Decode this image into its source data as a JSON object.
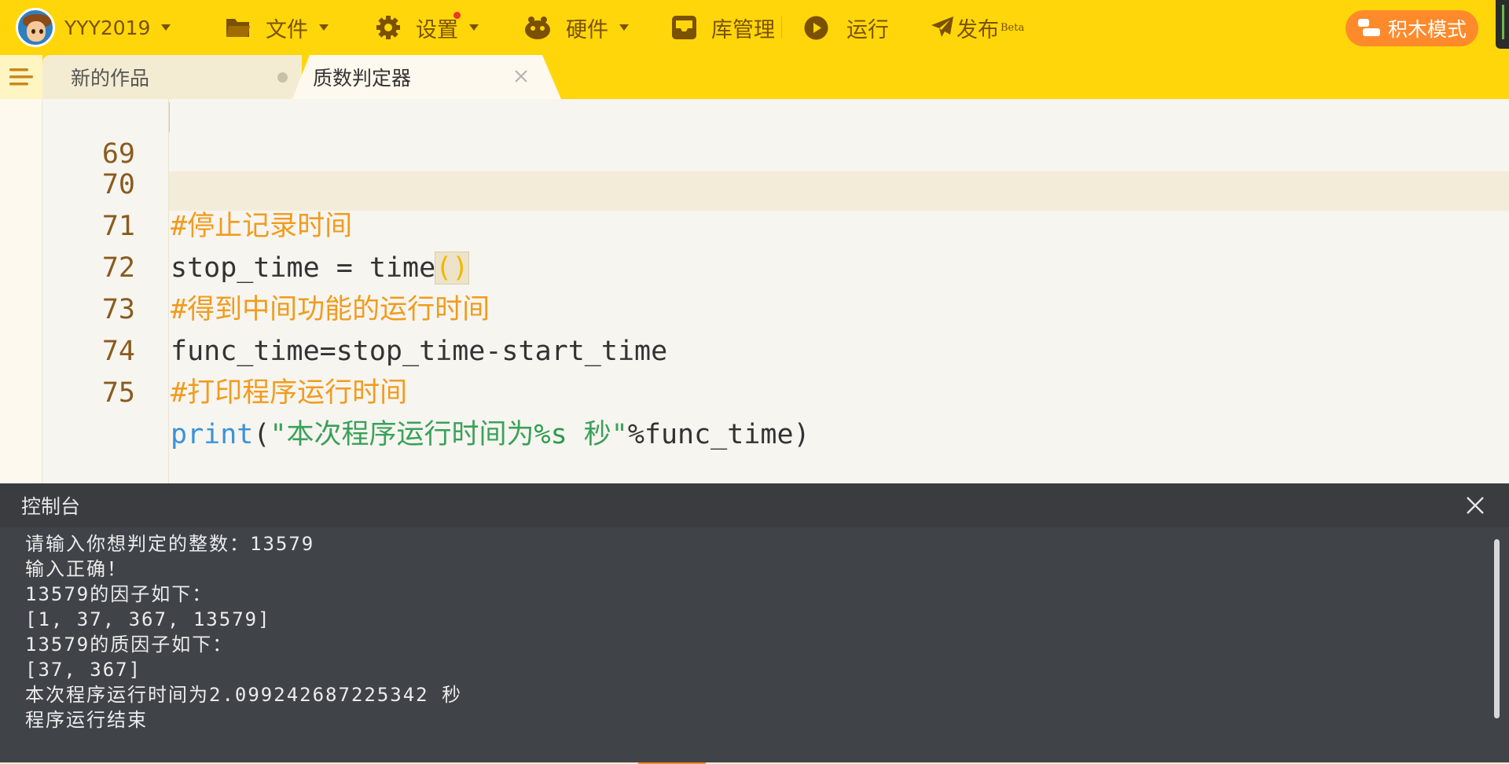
{
  "toolbar": {
    "username": "YYY2019",
    "file_label": "文件",
    "settings_label": "设置",
    "hardware_label": "硬件",
    "library_label": "库管理",
    "run_label": "运行",
    "publish_label": "发布",
    "publish_badge": "Beta",
    "block_mode_label": "积木模式"
  },
  "tabs": [
    {
      "label": "新的作品",
      "active": false
    },
    {
      "label": "质数判定器",
      "active": true
    }
  ],
  "editor": {
    "lines": [
      {
        "num": "69",
        "text": ""
      },
      {
        "num": "70",
        "text": "#停止记录时间"
      },
      {
        "num": "71",
        "before": "stop_time = time",
        "paren": "()"
      },
      {
        "num": "72",
        "text": "#得到中间功能的运行时间"
      },
      {
        "num": "73",
        "text": "func_time=stop_time-start_time"
      },
      {
        "num": "74",
        "text": "#打印程序运行时间"
      },
      {
        "num": "75",
        "func": "print",
        "open": "(",
        "str1": "\"本次程序运行时间为",
        "fmt": "%s",
        "str2": " 秒\"",
        "rest": "%func_time)"
      }
    ],
    "run_button_label": "运行"
  },
  "console": {
    "title": "控制台",
    "lines": [
      "请输入你想判定的整数：13579",
      "输入正确！",
      "13579的因子如下：",
      "[1, 37, 367, 13579]",
      "13579的质因子如下：",
      "[37, 367]",
      "本次程序运行时间为2.099242687225342 秒",
      "程序运行结束"
    ]
  },
  "colors": {
    "toolbar_bg": "#ffd60a",
    "toolbar_text": "#7a5100",
    "accent_orange": "#ff8a2b",
    "comment": "#f29b1d",
    "function": "#3b92d9",
    "string": "#3aa15a",
    "console_bg": "#404347"
  },
  "icons": {
    "avatar": "user-avatar",
    "file": "folder-icon",
    "settings": "gear-icon",
    "hardware": "robot-icon",
    "library": "inbox-icon",
    "run": "play-circle-icon",
    "publish": "paper-plane-icon",
    "block_mode": "blocks-icon",
    "menu": "menu-icon",
    "close": "close-icon"
  }
}
